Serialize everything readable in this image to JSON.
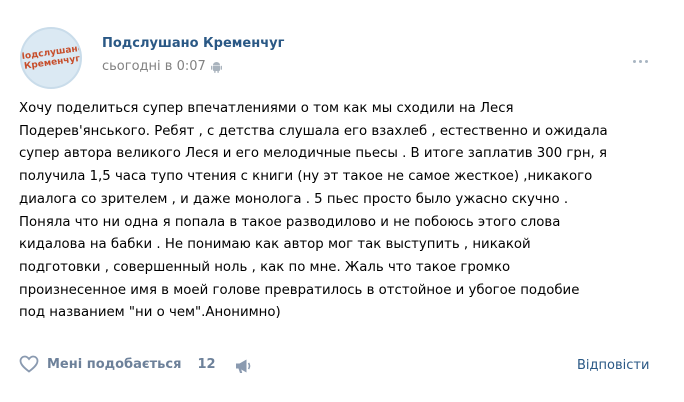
{
  "post": {
    "author": "Подслушано Кременчуг",
    "time": "сьогодні в 0:07",
    "avatar_text": "Подслушано Кременчуг",
    "text_lines": [
      "Хочу поделиться супер впечатлениями о том как мы сходили на Леся",
      "Подерев'янського. Ребят , с детства слушала его взахлеб , естественно и ожидала",
      "супер автора великого Леся и его мелодичные пьесы . В итоге заплатив 300 грн, я",
      "получила 1,5 часа тупо чтения с книги (ну эт такое не самое жесткое) ,никакого",
      "диалога со зрителем , и даже монолога . 5 пьес просто было ужасно скучно .",
      "Поняла что ни одна я попала в такое разводилово и не побоюсь этого слова",
      "кидалова на бабки . Не понимаю как автор мог так выступить , никакой",
      "подготовки , совершенный ноль , как по мне. Жаль что такое громко",
      "произнесенное имя в моей голове превратилось в отстойное и убогое подобие",
      "под названием \"ни о чем\".Анонимно)"
    ]
  },
  "footer": {
    "like_label": "Мені подобається",
    "like_count": "12",
    "reply_label": "Відповісти"
  },
  "icons": {
    "like": "heart-icon",
    "share": "megaphone-icon",
    "platform": "android-icon",
    "more": "more-dots-icon"
  },
  "colors": {
    "link": "#2a5885",
    "meta": "#828282",
    "action": "#6d819a"
  }
}
